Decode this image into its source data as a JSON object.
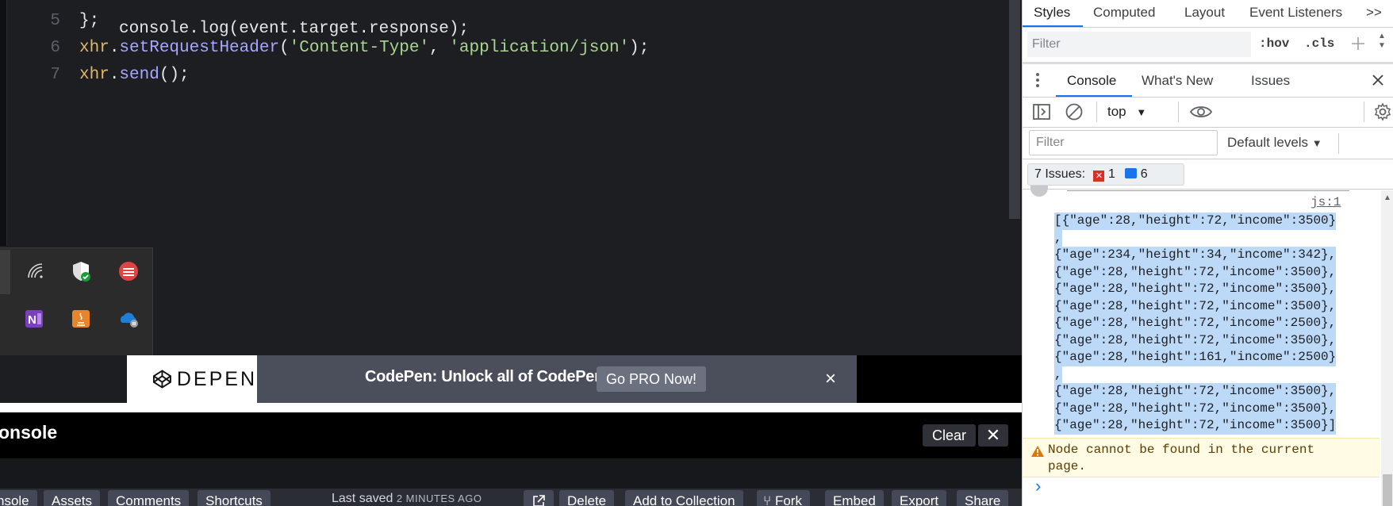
{
  "editor": {
    "lines": [
      {
        "num": "5",
        "tokens": [
          [
            "pun",
            "};"
          ]
        ]
      },
      {
        "num": "6",
        "tokens": [
          [
            "var",
            "xhr"
          ],
          [
            "pun",
            "."
          ],
          [
            "fn",
            "setRequestHeader"
          ],
          [
            "pun",
            "("
          ],
          [
            "str",
            "'Content-Type'"
          ],
          [
            "pun",
            ", "
          ],
          [
            "str",
            "'application/json'"
          ],
          [
            "pun",
            ");"
          ]
        ]
      },
      {
        "num": "7",
        "tokens": [
          [
            "var",
            "xhr"
          ],
          [
            "pun",
            "."
          ],
          [
            "fn",
            "send"
          ],
          [
            "pun",
            "();"
          ]
        ]
      }
    ],
    "partial_top_line": "console.log(event.target.response);"
  },
  "banner": {
    "logo_text": "DEPEN",
    "message": "CodePen: Unlock all of CodePen",
    "cta": "Go PRO Now!",
    "close": "×"
  },
  "console_panel": {
    "title": "onsole",
    "clear_label": "Clear",
    "close_label": "✕"
  },
  "footer": {
    "buttons_left": [
      "nsole",
      "Assets",
      "Comments",
      "Shortcuts"
    ],
    "saved_label": "Last saved",
    "saved_ago": "2 MINUTES AGO",
    "buttons_right": [
      "Delete",
      "Add to Collection",
      "Fork",
      "Embed",
      "Export",
      "Share"
    ]
  },
  "tray": {
    "icons": [
      "wifi-icon",
      "security-shield-icon",
      "red-app-icon",
      "onenote-icon",
      "java-icon",
      "onedrive-icon",
      "copy-icon"
    ]
  },
  "devtools": {
    "tabs": [
      "Styles",
      "Computed",
      "Layout",
      "Event Listeners",
      ">>"
    ],
    "filter_placeholder": "Filter",
    "hov": ":hov",
    "cls": ".cls",
    "drawer_tabs": [
      "Console",
      "What's New",
      "Issues"
    ],
    "context": "top",
    "console_filter_placeholder": "Filter",
    "levels": "Default levels",
    "issues_label": "7 Issues:",
    "issues_errors": "1",
    "issues_info": "6",
    "source_link": "js:1",
    "json_lines": [
      "[{\"age\":28,\"height\":72,\"income\":3500}",
      ",",
      "{\"age\":234,\"height\":34,\"income\":342},",
      "{\"age\":28,\"height\":72,\"income\":3500},",
      "{\"age\":28,\"height\":72,\"income\":3500},",
      "{\"age\":28,\"height\":72,\"income\":3500},",
      "{\"age\":28,\"height\":72,\"income\":2500},",
      "{\"age\":28,\"height\":72,\"income\":3500},",
      "{\"age\":28,\"height\":161,\"income\":2500}",
      ",",
      "{\"age\":28,\"height\":72,\"income\":3500},",
      "{\"age\":28,\"height\":72,\"income\":3500},",
      "{\"age\":28,\"height\":72,\"income\":3500}]"
    ],
    "warning": "Node cannot be found in the current page.",
    "prompt": "›"
  }
}
